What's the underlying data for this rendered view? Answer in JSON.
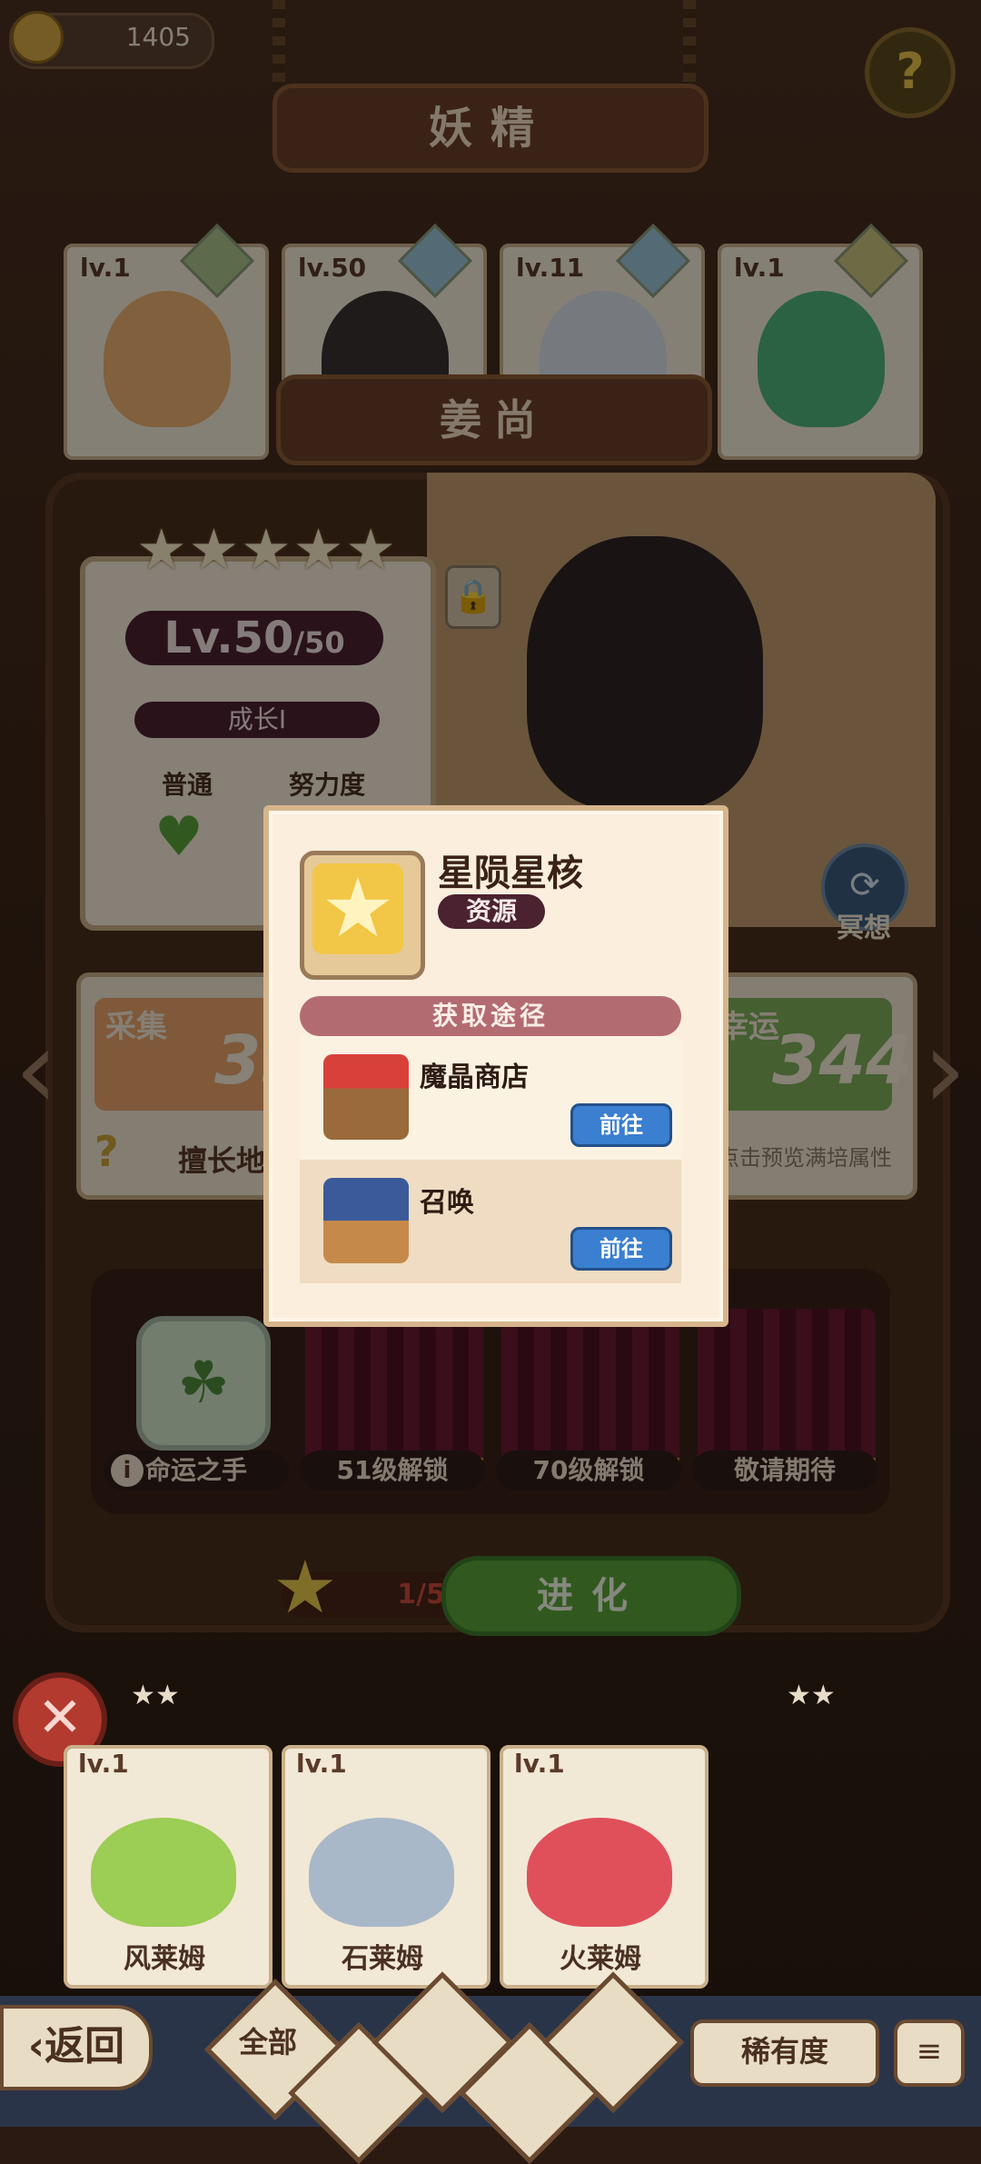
{
  "top_bar": {
    "coins": "1405",
    "help_icon": "question-icon"
  },
  "header": {
    "title": "妖精",
    "character_name": "姜尚"
  },
  "top_cards": [
    {
      "level": "lv.1",
      "color": "#e9b070"
    },
    {
      "level": "lv.50",
      "color": "#3a3230"
    },
    {
      "level": "lv.11",
      "color": "#d8dde6"
    },
    {
      "level": "lv.1",
      "color": "#4fb37a"
    }
  ],
  "info": {
    "stars": "★★★★★",
    "level": "Lv.50",
    "level_max": "/50",
    "growth": "成长I",
    "type_label": "普通",
    "effort_label": "努力度"
  },
  "meditate": {
    "label": "冥想"
  },
  "stats": {
    "left_title": "采集",
    "left_value": "35",
    "left_sub": "擅长地",
    "right_title": "幸运",
    "right_value": "344",
    "right_sub": "点击预览满培属性"
  },
  "skills": [
    {
      "label": "命运之手"
    },
    {
      "label": "51级解锁"
    },
    {
      "label": "70级解锁"
    },
    {
      "label": "敬请期待"
    }
  ],
  "evolve": {
    "progress": "1/5",
    "button": "进化"
  },
  "pets": [
    {
      "level": "lv.1",
      "name": "风莱姆",
      "color": "#9ccd55"
    },
    {
      "level": "lv.1",
      "name": "石莱姆",
      "color": "#a8b8c8"
    },
    {
      "level": "lv.1",
      "name": "火莱姆",
      "color": "#e0505a"
    }
  ],
  "pet_stars": {
    "left": "★★",
    "right": "★★"
  },
  "bottom": {
    "back": "返回",
    "all": "全部",
    "rarity": "稀有度"
  },
  "popup": {
    "item_name": "星陨星核",
    "item_type": "资源",
    "path_title": "获取途径",
    "sources": [
      {
        "name": "魔晶商店",
        "button": "前往"
      },
      {
        "name": "召唤",
        "button": "前往"
      }
    ]
  }
}
